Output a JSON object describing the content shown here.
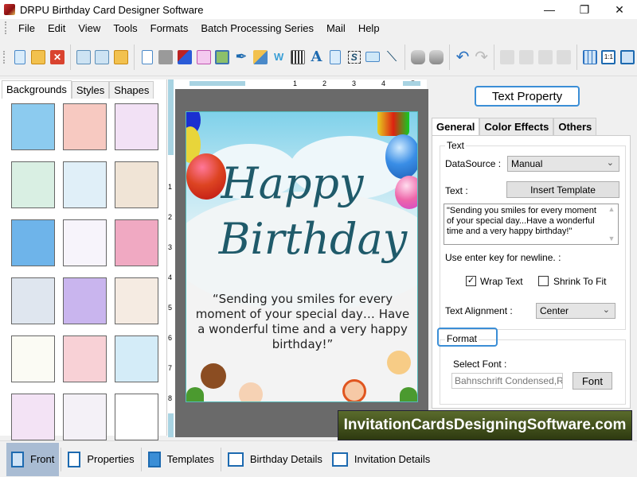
{
  "window": {
    "title": "DRPU Birthday Card Designer Software",
    "controls": [
      "minimize",
      "restore",
      "close"
    ]
  },
  "menu": [
    "File",
    "Edit",
    "View",
    "Tools",
    "Formats",
    "Batch Processing Series",
    "Mail",
    "Help"
  ],
  "toolbar": {
    "groups": [
      [
        "new-file-icon",
        "open-folder-icon",
        "close-red-x-icon"
      ],
      [
        "save-icon",
        "save-as-icon",
        "export-folder-icon"
      ],
      [
        "properties-icon",
        "print-icon",
        "layers-icon",
        "gift-icon",
        "image-add-icon",
        "pen-icon",
        "shape-picker-icon",
        "wordart-icon",
        "barcode-icon",
        "text-a-icon",
        "text-doc-icon",
        "signature-icon",
        "mail-icon",
        "line-icon"
      ],
      [
        "database-add-icon",
        "database-icon"
      ],
      [
        "undo-icon",
        "redo-icon"
      ],
      [
        "cut-icon",
        "copy-icon",
        "paste-icon",
        "delete-icon"
      ],
      [
        "grid-icon",
        "actual-size-icon",
        "fit-window-icon"
      ]
    ]
  },
  "left_panel": {
    "tabs": [
      "Backgrounds",
      "Styles",
      "Shapes"
    ],
    "active_tab": "Backgrounds",
    "thumbnails": [
      {
        "name": "blue-clouds",
        "color": "#8ccbef"
      },
      {
        "name": "pink-pattern",
        "color": "#f7c9c1"
      },
      {
        "name": "butterflies",
        "color": "#f2e1f5"
      },
      {
        "name": "flowers",
        "color": "#d9efe3"
      },
      {
        "name": "teddy-bears",
        "color": "#e0eff8"
      },
      {
        "name": "balloon-bird",
        "color": "#f0e4d6"
      },
      {
        "name": "stars-blue",
        "color": "#6eb4ea"
      },
      {
        "name": "pastel-balloons",
        "color": "#f7f4fb"
      },
      {
        "name": "pink-party",
        "color": "#f0a9c2"
      },
      {
        "name": "bubbles",
        "color": "#dfe6ef"
      },
      {
        "name": "rainbow-pastel",
        "color": "#c9b5ee"
      },
      {
        "name": "teddy-beige",
        "color": "#f5ebe2"
      },
      {
        "name": "happy-birthday-text",
        "color": "#fbfbf4"
      },
      {
        "name": "pink-hearts-stripes",
        "color": "#f8d1d6"
      },
      {
        "name": "colorful-balloons",
        "color": "#d4ecf8"
      },
      {
        "name": "heart-outlines",
        "color": "#f3e3f5"
      },
      {
        "name": "balloon-bunches",
        "color": "#f4f1f7"
      },
      {
        "name": "red-hearts",
        "color": "#ffffff"
      }
    ]
  },
  "rulers": {
    "horizontal": [
      "1",
      "2",
      "3",
      "4",
      "5"
    ],
    "vertical": [
      "1",
      "2",
      "3",
      "4",
      "5",
      "6",
      "7",
      "8"
    ]
  },
  "card": {
    "title_line1": "Happy",
    "title_line2": "Birthday",
    "message": "“Sending you smiles for every moment of your special day… Have a wonderful time and a very happy birthday!”"
  },
  "right_panel": {
    "header_button": "Text Property",
    "tabs": [
      "General",
      "Color Effects",
      "Others"
    ],
    "active_tab": "General",
    "text_group": {
      "legend": "Text",
      "datasource_label": "DataSource :",
      "datasource_value": "Manual",
      "text_label": "Text :",
      "insert_template_button": "Insert Template",
      "text_value": "\"Sending you smiles for every moment of your special day...Have a wonderful time and a very happy birthday!\"",
      "newline_hint": "Use enter key for newline. :",
      "wrap_text_label": "Wrap Text",
      "wrap_text_checked": true,
      "shrink_to_fit_label": "Shrink To Fit",
      "shrink_to_fit_checked": false,
      "alignment_label": "Text Alignment :",
      "alignment_value": "Center"
    },
    "format_group": {
      "legend": "Format",
      "select_font_label": "Select Font :",
      "font_value": "Bahnschrift Condensed,Regular",
      "font_button": "Font"
    }
  },
  "watermark": "InvitationCardsDesigningSoftware.com",
  "bottom_bar": {
    "items": [
      {
        "label": "Front",
        "active": true
      },
      {
        "label": "Properties",
        "active": false
      },
      {
        "label": "Templates",
        "active": false
      },
      {
        "label": "Birthday Details",
        "active": false
      },
      {
        "label": "Invitation Details",
        "active": false
      }
    ]
  }
}
